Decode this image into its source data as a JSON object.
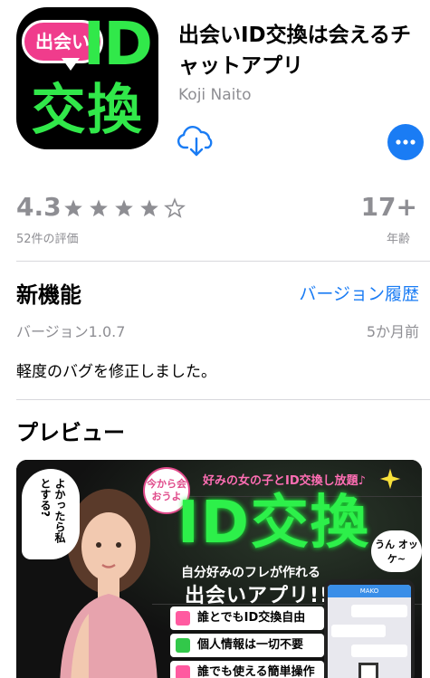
{
  "app": {
    "icon_bubble_text": "出会い",
    "icon_id_text": "ID",
    "icon_kanji_text": "交換",
    "title": "出会いID交換は会えるチャットアプリ",
    "developer": "Koji Naito"
  },
  "ratings": {
    "value": "4.3",
    "stars": 4.3,
    "count_label": "52件の評価",
    "age": "17+",
    "age_label": "年齢"
  },
  "whats_new": {
    "title": "新機能",
    "history_link": "バージョン履歴",
    "version": "バージョン1.0.7",
    "date": "5か月前",
    "note": "軽度のバグを修正しました。"
  },
  "preview": {
    "title": "プレビュー",
    "side_bubble": "よかったら私とする?",
    "badge": "今から会おうよ",
    "tagline": "好みの女の子とID交換し放題♪",
    "headline": "ID交換",
    "ok_bubble": "うん オッケ~",
    "sub_tag": "自分好みのフレが作れる",
    "sub_title": "出会いアプリ!!",
    "features": [
      "誰とでもID交換自由",
      "個人情報は一切不要",
      "誰でも使える簡単操作"
    ],
    "phone_header": "MAKO"
  },
  "colors": {
    "accent": "#1a7cf4",
    "icon_green": "#31e84a",
    "icon_pink": "#f03c8c",
    "secondary_text": "#8e8e93"
  }
}
